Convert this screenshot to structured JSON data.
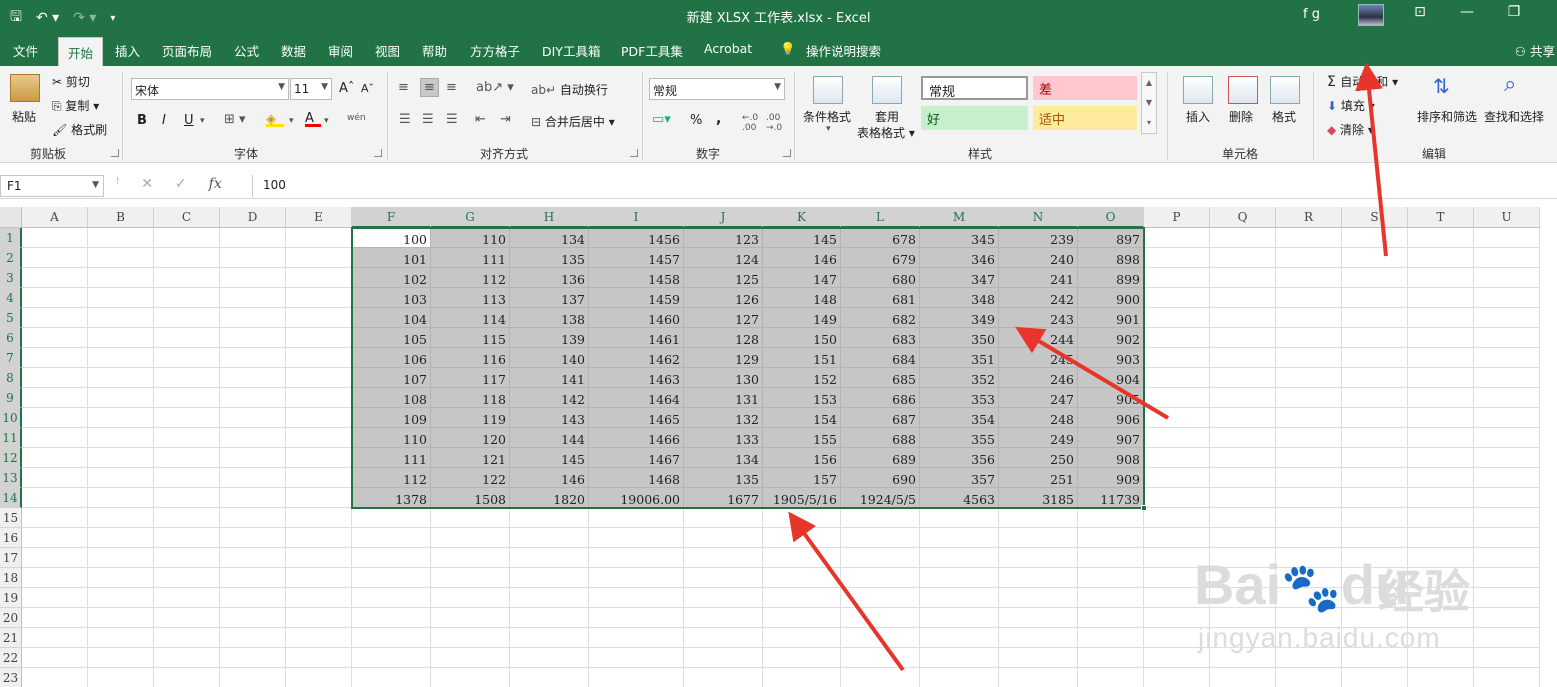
{
  "titlebar": {
    "title": "新建 XLSX 工作表.xlsx  -  Excel",
    "user": "f g",
    "qat": {
      "save_icon": "save-icon",
      "undo_icon": "undo-icon",
      "redo_icon": "redo-icon",
      "more_icon": "customize-qat-icon"
    }
  },
  "tabs": [
    "文件",
    "开始",
    "插入",
    "页面布局",
    "公式",
    "数据",
    "审阅",
    "视图",
    "帮助",
    "方方格子",
    "DIY工具箱",
    "PDF工具集",
    "Acrobat"
  ],
  "active_tab": "开始",
  "tell_me": "操作说明搜索",
  "share": "共享",
  "ribbon": {
    "clipboard": {
      "label": "剪贴板",
      "paste": "粘贴",
      "cut": "剪切",
      "copy": "复制",
      "format_painter": "格式刷"
    },
    "font": {
      "label": "字体",
      "family": "宋体",
      "size": "11",
      "bold": "B",
      "italic": "I",
      "underline": "U",
      "grow": "A",
      "shrink": "A",
      "font_color": "A",
      "phonetic": "wén"
    },
    "alignment": {
      "label": "对齐方式",
      "wrap": "自动换行",
      "merge": "合并后居中"
    },
    "number": {
      "label": "数字",
      "format": "常规",
      "percent": "%",
      "comma": ","
    },
    "styles": {
      "label": "样式",
      "conditional": "条件格式",
      "table_fmt": "套用",
      "table_fmt2": "表格格式",
      "normal": "常规",
      "bad": "差",
      "good": "好",
      "neutral": "适中"
    },
    "cells": {
      "label": "单元格",
      "insert": "插入",
      "delete": "删除",
      "format": "格式"
    },
    "editing": {
      "label": "编辑",
      "autosum": "自动求和",
      "fill": "填充",
      "clear": "清除",
      "sort": "排序和筛选",
      "find": "查找和选择"
    }
  },
  "formula_bar": {
    "name_box": "F1",
    "value": "100",
    "fx": "fx"
  },
  "columns": [
    "A",
    "B",
    "C",
    "D",
    "E",
    "F",
    "G",
    "H",
    "I",
    "J",
    "K",
    "L",
    "M",
    "N",
    "O",
    "P",
    "Q",
    "R",
    "S",
    "T",
    "U"
  ],
  "rows": [
    "1",
    "2",
    "3",
    "4",
    "5",
    "6",
    "7",
    "8",
    "9",
    "10",
    "11",
    "12",
    "13",
    "14",
    "15",
    "16",
    "17",
    "18",
    "19",
    "20",
    "21",
    "22",
    "23"
  ],
  "data": [
    [
      "100",
      "110",
      "134",
      "1456",
      "123",
      "145",
      "678",
      "345",
      "239",
      "897"
    ],
    [
      "101",
      "111",
      "135",
      "1457",
      "124",
      "146",
      "679",
      "346",
      "240",
      "898"
    ],
    [
      "102",
      "112",
      "136",
      "1458",
      "125",
      "147",
      "680",
      "347",
      "241",
      "899"
    ],
    [
      "103",
      "113",
      "137",
      "1459",
      "126",
      "148",
      "681",
      "348",
      "242",
      "900"
    ],
    [
      "104",
      "114",
      "138",
      "1460",
      "127",
      "149",
      "682",
      "349",
      "243",
      "901"
    ],
    [
      "105",
      "115",
      "139",
      "1461",
      "128",
      "150",
      "683",
      "350",
      "244",
      "902"
    ],
    [
      "106",
      "116",
      "140",
      "1462",
      "129",
      "151",
      "684",
      "351",
      "245",
      "903"
    ],
    [
      "107",
      "117",
      "141",
      "1463",
      "130",
      "152",
      "685",
      "352",
      "246",
      "904"
    ],
    [
      "108",
      "118",
      "142",
      "1464",
      "131",
      "153",
      "686",
      "353",
      "247",
      "905"
    ],
    [
      "109",
      "119",
      "143",
      "1465",
      "132",
      "154",
      "687",
      "354",
      "248",
      "906"
    ],
    [
      "110",
      "120",
      "144",
      "1466",
      "133",
      "155",
      "688",
      "355",
      "249",
      "907"
    ],
    [
      "111",
      "121",
      "145",
      "1467",
      "134",
      "156",
      "689",
      "356",
      "250",
      "908"
    ],
    [
      "112",
      "122",
      "146",
      "1468",
      "135",
      "157",
      "690",
      "357",
      "251",
      "909"
    ],
    [
      "1378",
      "1508",
      "1820",
      "19006.00",
      "1677",
      "1905/5/16",
      "1924/5/5",
      "4563",
      "3185",
      "11739"
    ]
  ],
  "watermark": {
    "brand": "Bai",
    "brand2": "du",
    "cn": "经验",
    "url": "jingyan.baidu.com"
  },
  "colors": {
    "accent": "#217346",
    "annotation": "#e8352b"
  }
}
